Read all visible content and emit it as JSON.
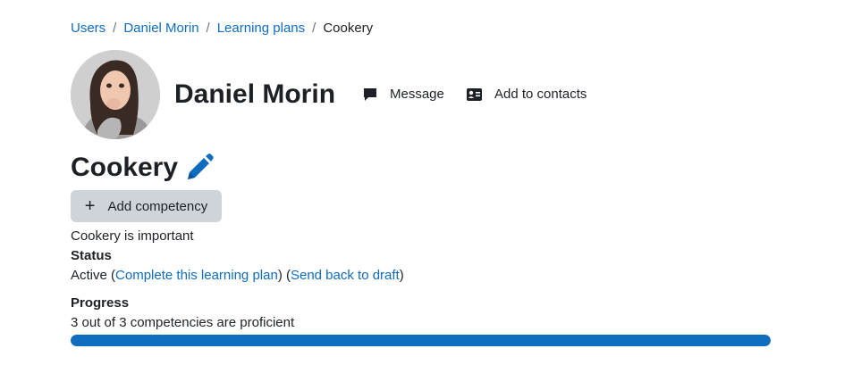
{
  "breadcrumb": {
    "items": [
      {
        "label": "Users"
      },
      {
        "label": "Daniel Morin"
      },
      {
        "label": "Learning plans"
      },
      {
        "label": "Cookery"
      }
    ],
    "separator": "/"
  },
  "user": {
    "name": "Daniel Morin"
  },
  "header_actions": {
    "message_label": "Message",
    "add_contact_label": "Add to contacts"
  },
  "plan": {
    "title": "Cookery",
    "add_competency_label": "Add competency",
    "description": "Cookery is important",
    "status_heading": "Status",
    "status_value": "Active",
    "complete_link": "Complete this learning plan",
    "draft_link": "Send back to draft",
    "progress_heading": "Progress",
    "progress_text": "3 out of 3 competencies are proficient",
    "progress_fraction": 1.0
  },
  "colors": {
    "link": "#0f6cbf",
    "progress": "#0f6cbf",
    "button_bg": "#ced4da"
  },
  "icons": {
    "message": "comment-icon",
    "add_contact": "address-card-icon",
    "edit": "pencil-icon",
    "add": "plus-icon"
  }
}
